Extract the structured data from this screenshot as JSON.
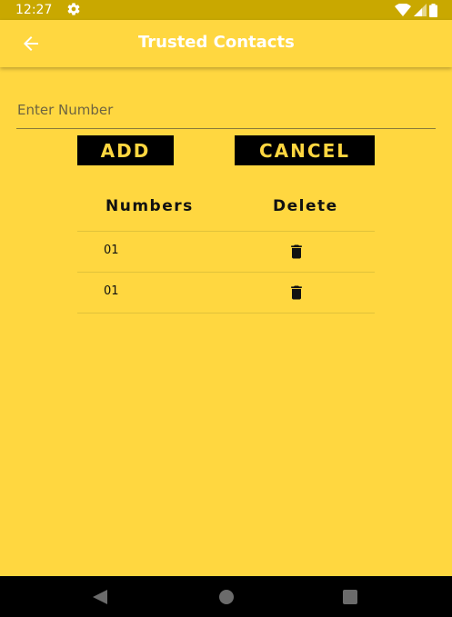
{
  "status_bar": {
    "time": "12:27",
    "icons": [
      "gear-icon",
      "wifi-icon",
      "signal-icon",
      "battery-icon"
    ]
  },
  "app_bar": {
    "title": "Trusted Contacts",
    "back_icon": "arrow-left-icon"
  },
  "form": {
    "number_placeholder": "Enter Number",
    "number_value": "",
    "add_label": "ADD",
    "cancel_label": "CANCEL"
  },
  "table": {
    "headers": {
      "numbers": "Numbers",
      "delete": "Delete"
    },
    "rows": [
      {
        "number": "01",
        "delete_icon": "trash-icon"
      },
      {
        "number": "01",
        "delete_icon": "trash-icon"
      }
    ]
  },
  "nav_bar": {
    "icons": [
      "back-triangle-icon",
      "home-circle-icon",
      "recents-square-icon"
    ]
  },
  "colors": {
    "background": "#FFD740",
    "status_bar": "#C9A800",
    "button_bg": "#000000",
    "button_text": "#FFD740",
    "nav_bar": "#000000"
  }
}
